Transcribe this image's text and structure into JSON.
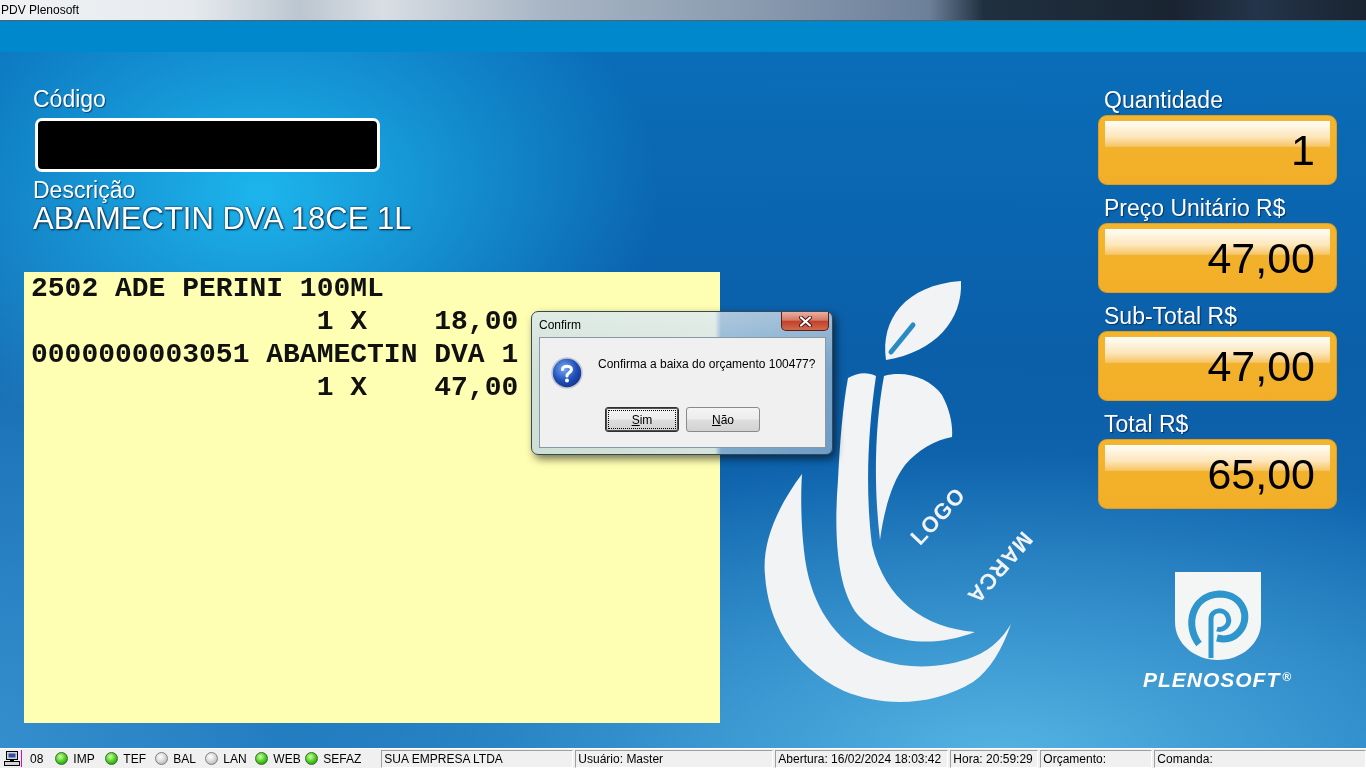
{
  "window": {
    "title": "PDV Plenosoft"
  },
  "code_field": {
    "label": "Código"
  },
  "description": {
    "label": "Descrição",
    "value": "ABAMECTIN DVA 18CE 1L"
  },
  "receipt": {
    "items": [
      {
        "line": "2502 ADE PERINI 100ML",
        "quantity": "1 X",
        "price": "18,00"
      },
      {
        "line": "0000000003051 ABAMECTIN DVA 1",
        "quantity": "1 X",
        "price": "47,00"
      }
    ]
  },
  "displays": [
    {
      "title": "Quantidade",
      "value": "1"
    },
    {
      "title": "Preço Unitário R$",
      "value": "47,00"
    },
    {
      "title": "Sub-Total R$",
      "value": "47,00"
    },
    {
      "title": "Total R$",
      "value": "65,00"
    }
  ],
  "logo_placeholder": {
    "words": [
      "LOGO",
      "MARCA"
    ]
  },
  "brand": {
    "name": "PLENOSOFT$^{®}$"
  },
  "dialog": {
    "title": "Confirm",
    "message": "Confirma a baixa do orçamento 100477?",
    "buttons": [
      {
        "label": "Sim",
        "focused": true
      },
      {
        "label": "Não",
        "focused": false
      }
    ]
  },
  "status_bar": {
    "terminal": "08",
    "indicators": [
      {
        "label": "IMP",
        "on": true
      },
      {
        "label": "TEF",
        "on": true
      },
      {
        "label": "BAL",
        "on": false
      },
      {
        "label": "LAN",
        "on": false
      },
      {
        "label": "WEB",
        "on": true
      },
      {
        "label": "SEFAZ",
        "on": true
      }
    ],
    "panels": [
      "SUA EMPRESA LTDA",
      "Usuário: Master",
      "Abertura: 16/02/2024 18:03:42",
      "Hora: 20:59:29",
      "Orçamento:",
      "Comanda:"
    ]
  }
}
